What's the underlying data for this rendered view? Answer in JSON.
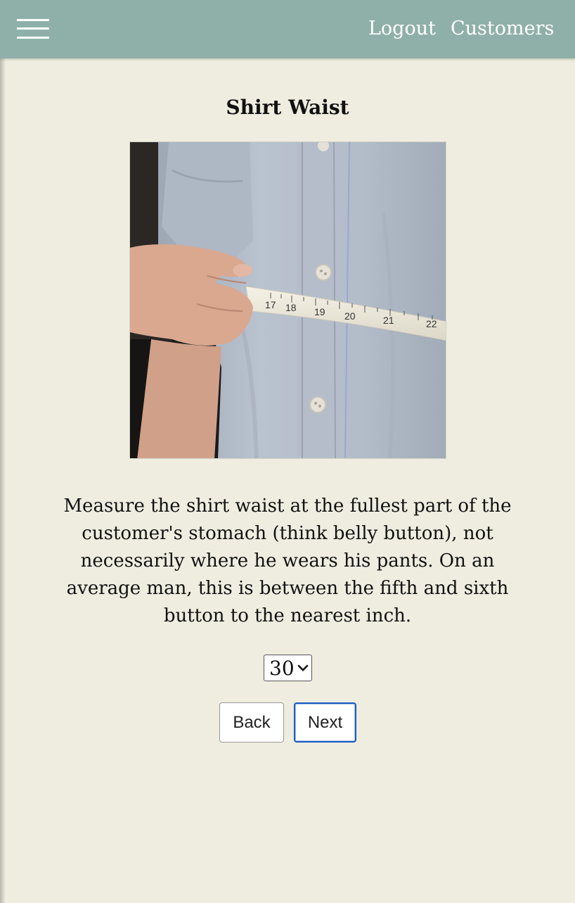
{
  "navbar": {
    "menu_icon": "hamburger-menu-icon",
    "links": [
      "Logout",
      "Customers"
    ]
  },
  "page": {
    "title": "Shirt Waist",
    "image_alt": "measuring-tape-around-shirt-waist",
    "description": "Measure the shirt waist at the fullest part of the customer's stomach (think belly button), not necessarily where he wears his pants. On an average man, this is between the fifth and sixth button to the nearest inch.",
    "measurement_select": {
      "value": "30"
    },
    "buttons": {
      "back": "Back",
      "next": "Next"
    }
  },
  "tape_numbers": [
    "17",
    "18",
    "19",
    "20",
    "21",
    "22"
  ],
  "colors": {
    "navbar": "#8fb0a8",
    "background": "#efede0",
    "focus_outline": "#1a5bc4"
  }
}
